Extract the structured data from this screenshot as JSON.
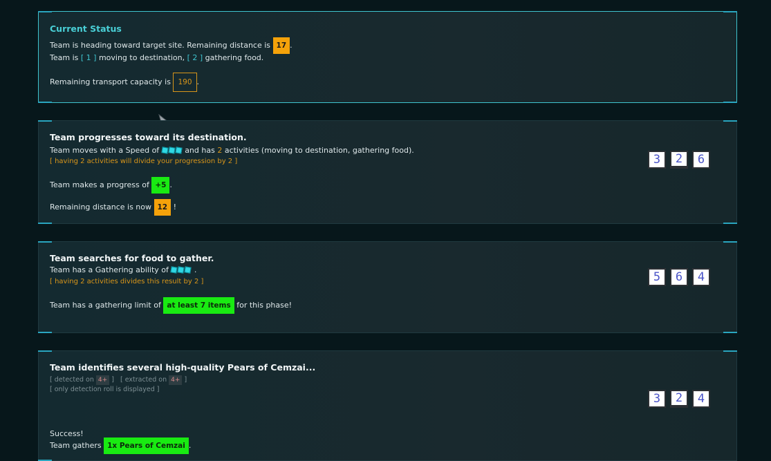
{
  "status": {
    "title": "Current Status",
    "line1_pre": "Team is heading toward target site. Remaining distance is",
    "line1_value": "17",
    "line1_post": ".",
    "line2_pre": "Team is",
    "line2_b1": "[ 1 ]",
    "line2_mid": "moving to destination,",
    "line2_b2": "[ 2 ]",
    "line2_post": "gathering food.",
    "line3_pre": "Remaining transport capacity is",
    "line3_value": "190",
    "line3_post": "."
  },
  "progress": {
    "title": "Team progresses toward its destination.",
    "speed_pre": "Team moves with a Speed of",
    "speed_mid": "and has",
    "activities_count": "2",
    "speed_post": "activities (moving to destination, gathering food).",
    "note": "[ having 2 activities will divide your progression by 2 ]",
    "makes_pre": "Team makes a progress of",
    "makes_value": "+5",
    "makes_post": ".",
    "remaining_pre": "Remaining distance is now",
    "remaining_value": "12",
    "remaining_post": "!",
    "dice": [
      "3",
      "2",
      "6"
    ]
  },
  "gather": {
    "title": "Team searches for food to gather.",
    "ability_pre": "Team has a Gathering ability of",
    "ability_post": ".",
    "note": "[ having 2 activities divides this result by 2 ]",
    "limit_pre": "Team has a gathering limit of",
    "limit_value": "at least 7 items",
    "limit_post": "for this phase!",
    "dice": [
      "5",
      "6",
      "4"
    ]
  },
  "identify": {
    "title": "Team identifies several high-quality Pears of Cemzai...",
    "detected_pre": "[ detected on",
    "detected_value": "4+",
    "detected_post": "]",
    "extracted_pre": "[ extracted on",
    "extracted_value": "4+",
    "extracted_post": "]",
    "only_note": "[ only detection roll is displayed ]",
    "success": "Success!",
    "gathers_pre": "Team gathers",
    "gathers_value": "1x Pears of Cemzai",
    "gathers_post": ".",
    "dice": [
      "3",
      "2",
      "4"
    ]
  },
  "icons": {
    "cube": "cube-icon",
    "cursor": "mouse-cursor"
  },
  "colors": {
    "accent": "#3fc5d0",
    "orange": "#f5a20a",
    "green": "#19ea12"
  }
}
